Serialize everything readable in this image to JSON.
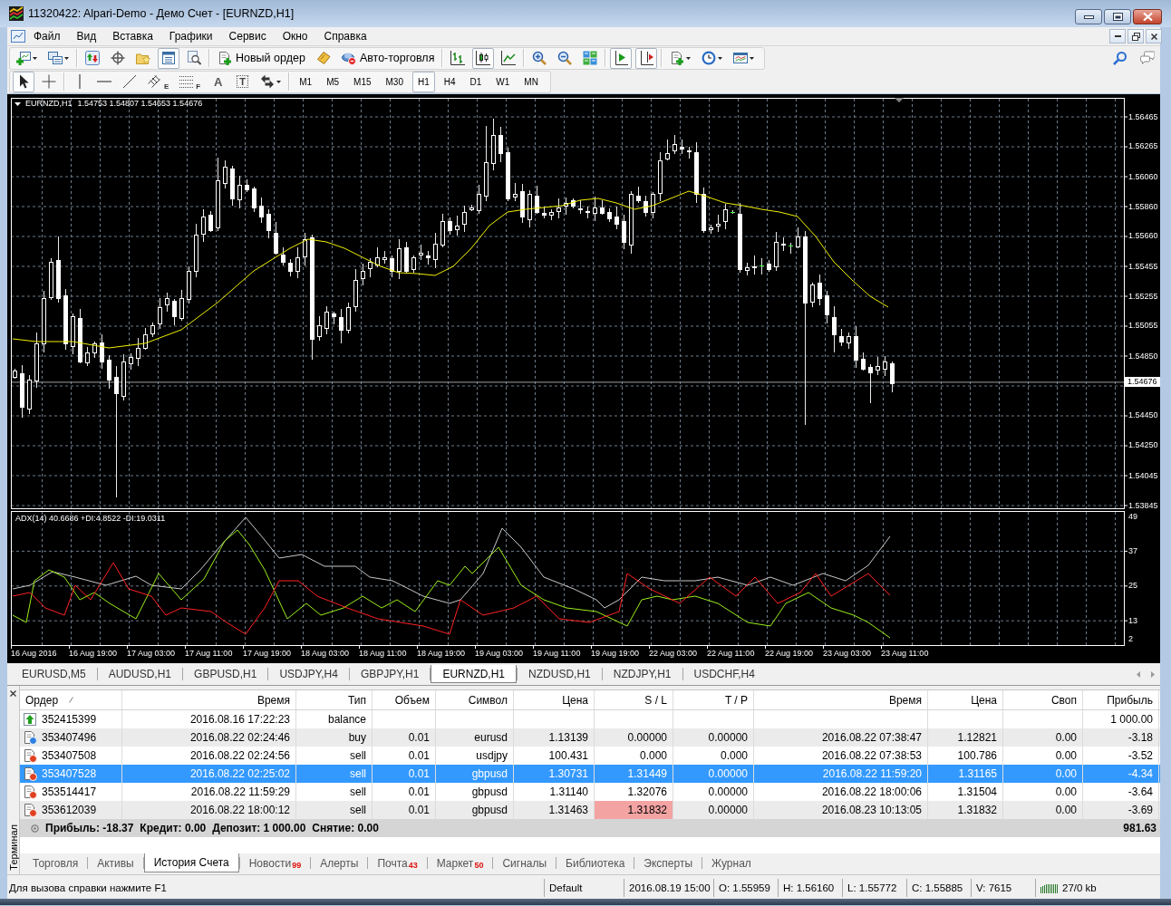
{
  "window": {
    "title": "11320422: Alpari-Demo - Демо Счет - [EURNZD,H1]"
  },
  "menu": [
    "Файл",
    "Вид",
    "Вставка",
    "Графики",
    "Сервис",
    "Окно",
    "Справка"
  ],
  "toolbar": {
    "groups": [
      {
        "items": [
          {
            "kind": "new-chart",
            "selected": false,
            "dropdown": true
          },
          {
            "kind": "profiles",
            "selected": false,
            "dropdown": true
          }
        ]
      },
      {
        "items": [
          {
            "kind": "market-watch",
            "selected": false
          },
          {
            "kind": "data-window",
            "selected": false
          },
          {
            "kind": "navigator",
            "selected": false
          },
          {
            "kind": "terminal",
            "selected": true
          },
          {
            "kind": "tester",
            "selected": false
          }
        ]
      },
      {
        "items": [
          {
            "kind": "new-order",
            "selected": false,
            "label": "Новый ордер"
          },
          {
            "kind": "editor",
            "selected": false
          },
          {
            "kind": "autotrading",
            "selected": false,
            "label": "Авто-торговля"
          }
        ]
      },
      {
        "items": [
          {
            "kind": "bar-chart",
            "selected": false
          },
          {
            "kind": "candles",
            "selected": true
          },
          {
            "kind": "line-chart",
            "selected": false
          }
        ]
      },
      {
        "items": [
          {
            "kind": "zoom-in",
            "selected": false
          },
          {
            "kind": "zoom-out",
            "selected": false
          },
          {
            "kind": "tile",
            "selected": false
          }
        ]
      },
      {
        "items": [
          {
            "kind": "autoscroll",
            "selected": true
          },
          {
            "kind": "chart-shift",
            "selected": true
          }
        ]
      },
      {
        "items": [
          {
            "kind": "indicators",
            "selected": false,
            "dropdown": true
          },
          {
            "kind": "periods",
            "selected": false,
            "dropdown": true
          },
          {
            "kind": "templates",
            "selected": false,
            "dropdown": true
          }
        ]
      }
    ],
    "right": [
      {
        "kind": "search"
      },
      {
        "kind": "chat"
      }
    ]
  },
  "drawing_toolbar": {
    "groups": [
      {
        "items": [
          {
            "kind": "cursor",
            "selected": true
          },
          {
            "kind": "crosshair",
            "selected": false
          }
        ]
      },
      {
        "items": [
          {
            "kind": "vertical-line",
            "selected": false
          },
          {
            "kind": "horizontal-line",
            "selected": false
          },
          {
            "kind": "trend-line",
            "selected": false
          },
          {
            "kind": "channel",
            "selected": false,
            "glyph": "E"
          },
          {
            "kind": "fibonacci",
            "selected": false,
            "glyph": "F"
          },
          {
            "kind": "text",
            "selected": false,
            "glyph": "A"
          },
          {
            "kind": "text-label",
            "selected": false,
            "glyph": "T"
          },
          {
            "kind": "arrows",
            "selected": false,
            "dropdown": true
          }
        ]
      },
      {
        "items": [
          {
            "kind": "period",
            "label": "M1",
            "selected": false
          },
          {
            "kind": "period",
            "label": "M5",
            "selected": false
          },
          {
            "kind": "period",
            "label": "M15",
            "selected": false
          },
          {
            "kind": "period",
            "label": "M30",
            "selected": false
          },
          {
            "kind": "period",
            "label": "H1",
            "selected": true
          },
          {
            "kind": "period",
            "label": "H4",
            "selected": false
          },
          {
            "kind": "period",
            "label": "D1",
            "selected": false
          },
          {
            "kind": "period",
            "label": "W1",
            "selected": false
          },
          {
            "kind": "period",
            "label": "MN",
            "selected": false
          }
        ]
      }
    ]
  },
  "chart": {
    "symbol": "EURNZD,H1",
    "ohlc": "1.54753 1.54807 1.54653 1.54676",
    "price_ticks": [
      "1.56465",
      "1.56265",
      "1.56060",
      "1.55860",
      "1.55660",
      "1.55455",
      "1.55255",
      "1.55055",
      "1.54850",
      "1.54450",
      "1.54250",
      "1.54045",
      "1.53845"
    ],
    "current_price": "1.54676",
    "indicator": {
      "legend": "ADX(14) 40.6686 +DI:4.8522 -DI:19.0311",
      "ticks": [
        "49",
        "37",
        "25",
        "13",
        "2"
      ]
    },
    "time_labels": [
      "16 Aug 2016",
      "16 Aug 19:00",
      "17 Aug 03:00",
      "17 Aug 11:00",
      "17 Aug 19:00",
      "18 Aug 03:00",
      "18 Aug 11:00",
      "18 Aug 19:00",
      "19 Aug 03:00",
      "19 Aug 11:00",
      "19 Aug 19:00",
      "22 Aug 03:00",
      "22 Aug 11:00",
      "22 Aug 19:00",
      "23 Aug 03:00",
      "23 Aug 11:00"
    ]
  },
  "chart_tabs": [
    {
      "label": "EURUSD,M5",
      "selected": false
    },
    {
      "label": "AUDUSD,H1",
      "selected": false
    },
    {
      "label": "GBPUSD,H1",
      "selected": false
    },
    {
      "label": "USDJPY,H4",
      "selected": false
    },
    {
      "label": "GBPJPY,H1",
      "selected": false
    },
    {
      "label": "EURNZD,H1",
      "selected": true
    },
    {
      "label": "NZDUSD,H1",
      "selected": false
    },
    {
      "label": "NZDJPY,H1",
      "selected": false
    },
    {
      "label": "USDCHF,H4",
      "selected": false
    }
  ],
  "terminal": {
    "title": "Терминал",
    "columns": [
      {
        "label": "Ордер",
        "sorted": true
      },
      {
        "label": "Время",
        "sorted": false
      },
      {
        "label": "Тип",
        "sorted": false
      },
      {
        "label": "Объем",
        "sorted": false
      },
      {
        "label": "Символ",
        "sorted": false
      },
      {
        "label": "Цена",
        "sorted": false
      },
      {
        "label": "S / L",
        "sorted": false
      },
      {
        "label": "T / P",
        "sorted": false
      },
      {
        "label": "Время",
        "sorted": false
      },
      {
        "label": "Цена",
        "sorted": false
      },
      {
        "label": "Своп",
        "sorted": false
      },
      {
        "label": "Прибыль",
        "sorted": false
      }
    ],
    "rows": [
      {
        "kind": "balance",
        "selected": false,
        "sl_hit": false,
        "order": "352415399",
        "open_time": "2016.08.16 17:22:23",
        "type": "balance",
        "profit": "1 000.00"
      },
      {
        "kind": "buy",
        "selected": false,
        "sl_hit": false,
        "order": "353407496",
        "open_time": "2016.08.22 02:24:46",
        "type": "buy",
        "volume": "0.01",
        "symbol": "eurusd",
        "open_price": "1.13139",
        "sl": "0.00000",
        "tp": "0.00000",
        "close_time": "2016.08.22 07:38:47",
        "close_price": "1.12821",
        "swap": "0.00",
        "profit": "-3.18"
      },
      {
        "kind": "sell",
        "selected": false,
        "sl_hit": false,
        "order": "353407508",
        "open_time": "2016.08.22 02:24:56",
        "type": "sell",
        "volume": "0.01",
        "symbol": "usdjpy",
        "open_price": "100.431",
        "sl": "0.000",
        "tp": "0.000",
        "close_time": "2016.08.22 07:38:53",
        "close_price": "100.786",
        "swap": "0.00",
        "profit": "-3.52"
      },
      {
        "kind": "sell",
        "selected": true,
        "sl_hit": false,
        "order": "353407528",
        "open_time": "2016.08.22 02:25:02",
        "type": "sell",
        "volume": "0.01",
        "symbol": "gbpusd",
        "open_price": "1.30731",
        "sl": "1.31449",
        "tp": "0.00000",
        "close_time": "2016.08.22 11:59:20",
        "close_price": "1.31165",
        "swap": "0.00",
        "profit": "-4.34"
      },
      {
        "kind": "sell",
        "selected": false,
        "sl_hit": false,
        "order": "353514417",
        "open_time": "2016.08.22 11:59:29",
        "type": "sell",
        "volume": "0.01",
        "symbol": "gbpusd",
        "open_price": "1.31140",
        "sl": "1.32076",
        "tp": "0.00000",
        "close_time": "2016.08.22 18:00:06",
        "close_price": "1.31504",
        "swap": "0.00",
        "profit": "-3.64"
      },
      {
        "kind": "sell",
        "selected": false,
        "sl_hit": true,
        "order": "353612039",
        "open_time": "2016.08.22 18:00:12",
        "type": "sell",
        "volume": "0.01",
        "symbol": "gbpusd",
        "open_price": "1.31463",
        "sl": "1.31832",
        "tp": "0.00000",
        "close_time": "2016.08.23 10:13:05",
        "close_price": "1.31832",
        "swap": "0.00",
        "profit": "-3.69"
      }
    ],
    "summary": {
      "items": [
        "Прибыль: -18.37",
        "Кредит: 0.00",
        "Депозит: 1 000.00",
        "Снятие: 0.00"
      ],
      "total": "981.63"
    },
    "tabs": [
      {
        "label": "Торговля",
        "selected": false
      },
      {
        "label": "Активы",
        "selected": false
      },
      {
        "label": "История Счета",
        "selected": true
      },
      {
        "label": "Новости",
        "badge": "99",
        "selected": false
      },
      {
        "label": "Алерты",
        "selected": false
      },
      {
        "label": "Почта",
        "badge": "43",
        "selected": false
      },
      {
        "label": "Маркет",
        "badge": "50",
        "selected": false
      },
      {
        "label": "Сигналы",
        "selected": false
      },
      {
        "label": "Библиотека",
        "selected": false
      },
      {
        "label": "Эксперты",
        "selected": false
      },
      {
        "label": "Журнал",
        "selected": false
      }
    ]
  },
  "status_bar": {
    "help": "Для вызова справки нажмите F1",
    "profile": "Default",
    "fields": [
      "2016.08.19 15:00",
      "O: 1.55959",
      "H: 1.56160",
      "L: 1.55772",
      "C: 1.55885",
      "V: 7615"
    ],
    "traffic": "27/0 kb"
  }
}
